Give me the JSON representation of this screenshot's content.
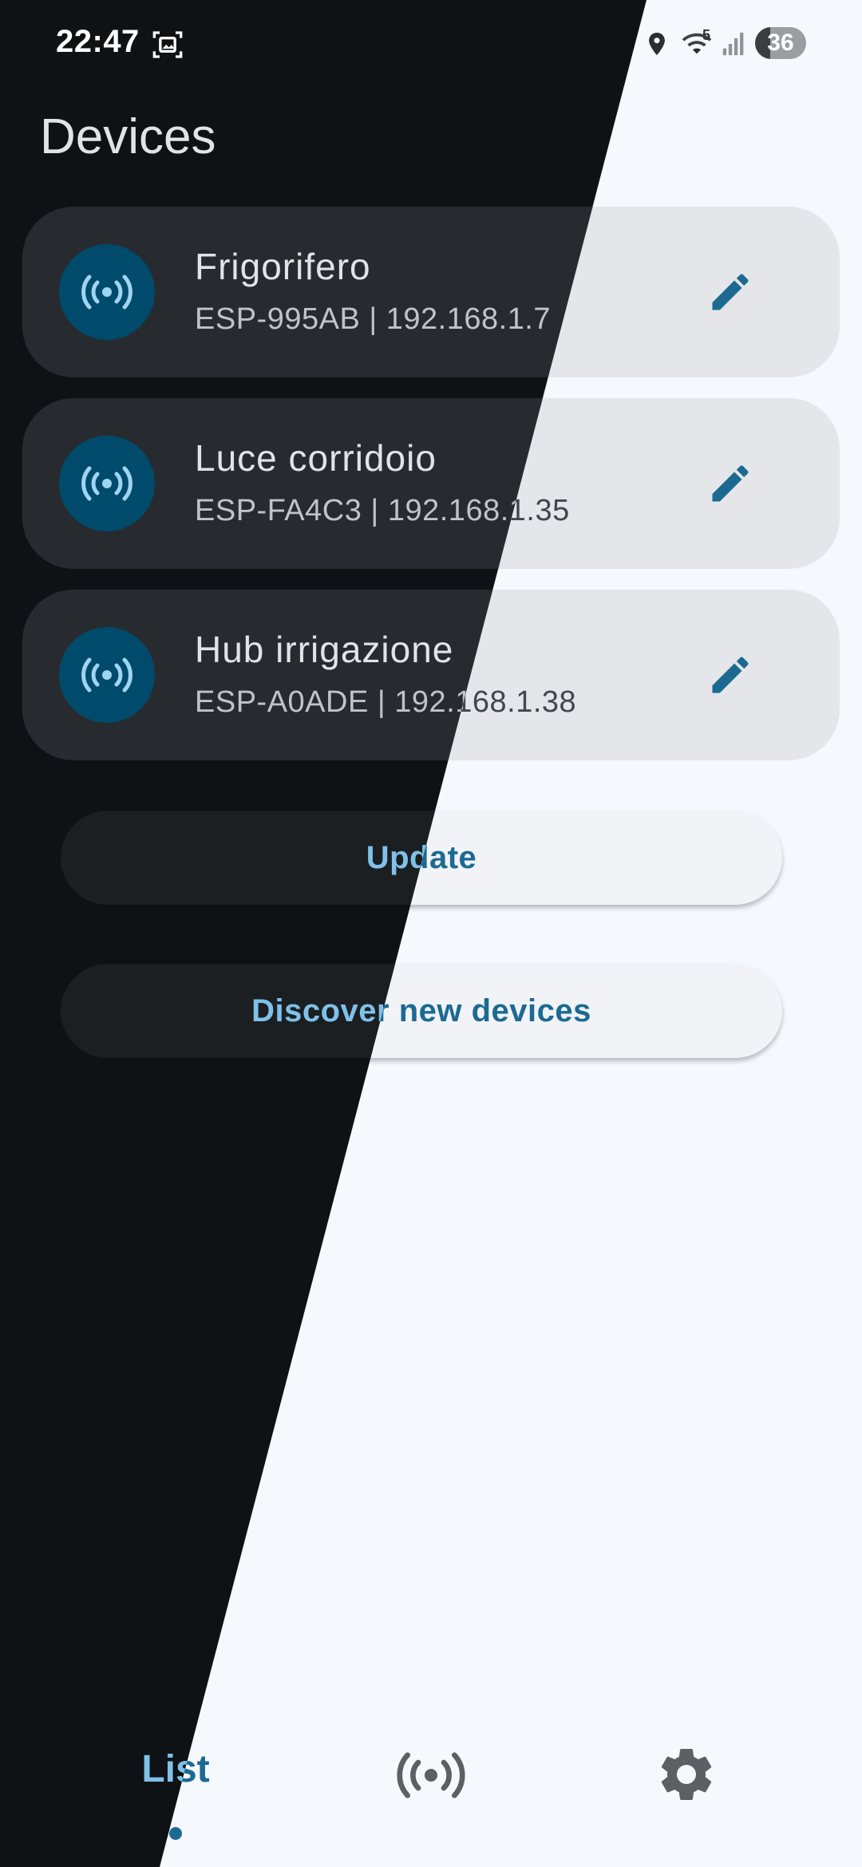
{
  "status_bar": {
    "time": "22:47",
    "wifi_badge": "5",
    "battery": "36",
    "icons": [
      "screenshot-icon",
      "location-icon",
      "wifi-icon",
      "signal-icon",
      "battery-icon"
    ]
  },
  "page": {
    "title": "Devices"
  },
  "devices": [
    {
      "name": "Frigorifero",
      "subtitle": "ESP-995AB | 192.168.1.7",
      "icon": "broadcast-icon",
      "action_icon": "pencil-icon"
    },
    {
      "name": "Luce corridoio",
      "subtitle": "ESP-FA4C3 | 192.168.1.35",
      "icon": "broadcast-icon",
      "action_icon": "pencil-icon"
    },
    {
      "name": "Hub irrigazione",
      "subtitle": "ESP-A0ADE | 192.168.1.38",
      "icon": "broadcast-icon",
      "action_icon": "pencil-icon"
    }
  ],
  "actions": {
    "update": "Update",
    "discover": "Discover new devices"
  },
  "bottom_nav": {
    "list_label": "List",
    "devices_icon": "broadcast-icon",
    "settings_icon": "gear-icon",
    "selected": "List"
  },
  "colors": {
    "light_background": "#f5f8fd",
    "dark_background": "#0e1215",
    "accent_light": "#1c6a92",
    "accent_dark": "#7fc1e8",
    "avatar": "#004a6c"
  }
}
